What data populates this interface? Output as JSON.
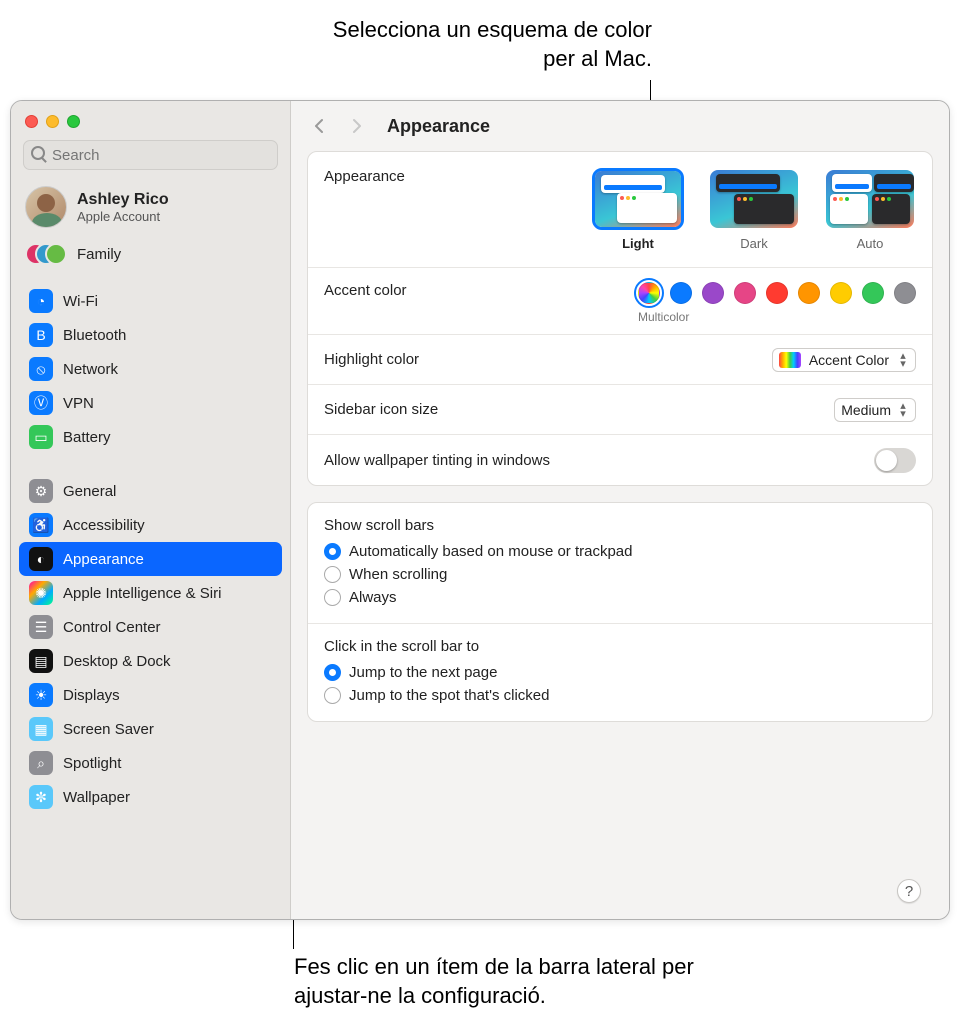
{
  "callouts": {
    "top": "Selecciona un esquema de color per al Mac.",
    "bottom": "Fes clic en un ítem de la barra lateral per ajustar-ne la configuració."
  },
  "search": {
    "placeholder": "Search"
  },
  "account": {
    "name": "Ashley Rico",
    "sub": "Apple Account"
  },
  "family": {
    "label": "Family"
  },
  "sidebar": {
    "group1": [
      {
        "label": "Wi-Fi",
        "icon": "wifi-icon",
        "bg": "bg-blue"
      },
      {
        "label": "Bluetooth",
        "icon": "bluetooth-icon",
        "bg": "bg-blue"
      },
      {
        "label": "Network",
        "icon": "globe-icon",
        "bg": "bg-blue"
      },
      {
        "label": "VPN",
        "icon": "vpn-icon",
        "bg": "bg-blue"
      },
      {
        "label": "Battery",
        "icon": "battery-icon",
        "bg": "bg-green"
      }
    ],
    "group2": [
      {
        "label": "General",
        "icon": "gear-icon",
        "bg": "bg-gray"
      },
      {
        "label": "Accessibility",
        "icon": "accessibility-icon",
        "bg": "bg-blue"
      },
      {
        "label": "Appearance",
        "icon": "appearance-icon",
        "bg": "bg-black",
        "selected": true
      },
      {
        "label": "Apple Intelligence & Siri",
        "icon": "siri-icon",
        "bg": "bg-rainbow"
      },
      {
        "label": "Control Center",
        "icon": "controlcenter-icon",
        "bg": "bg-gray"
      },
      {
        "label": "Desktop & Dock",
        "icon": "dock-icon",
        "bg": "bg-black"
      },
      {
        "label": "Displays",
        "icon": "displays-icon",
        "bg": "bg-blue"
      },
      {
        "label": "Screen Saver",
        "icon": "screensaver-icon",
        "bg": "bg-teal"
      },
      {
        "label": "Spotlight",
        "icon": "spotlight-icon",
        "bg": "bg-gray"
      },
      {
        "label": "Wallpaper",
        "icon": "wallpaper-icon",
        "bg": "bg-teal"
      }
    ]
  },
  "toolbar": {
    "title": "Appearance"
  },
  "appearance": {
    "label": "Appearance",
    "options": [
      {
        "label": "Light",
        "selected": true
      },
      {
        "label": "Dark"
      },
      {
        "label": "Auto"
      }
    ]
  },
  "accent": {
    "label": "Accent color",
    "selected_label": "Multicolor",
    "colors": [
      "multi",
      "#0a7aff",
      "#9a48c9",
      "#e64586",
      "#ff3b30",
      "#ff9500",
      "#ffcc00",
      "#34c759",
      "#8e8e93"
    ]
  },
  "highlight": {
    "label": "Highlight color",
    "value": "Accent Color"
  },
  "sidebar_icon": {
    "label": "Sidebar icon size",
    "value": "Medium"
  },
  "tinting": {
    "label": "Allow wallpaper tinting in windows",
    "on": false
  },
  "scrollbars": {
    "title": "Show scroll bars",
    "options": [
      "Automatically based on mouse or trackpad",
      "When scrolling",
      "Always"
    ],
    "selected": 0
  },
  "scrollclick": {
    "title": "Click in the scroll bar to",
    "options": [
      "Jump to the next page",
      "Jump to the spot that's clicked"
    ],
    "selected": 0
  },
  "help": "?"
}
